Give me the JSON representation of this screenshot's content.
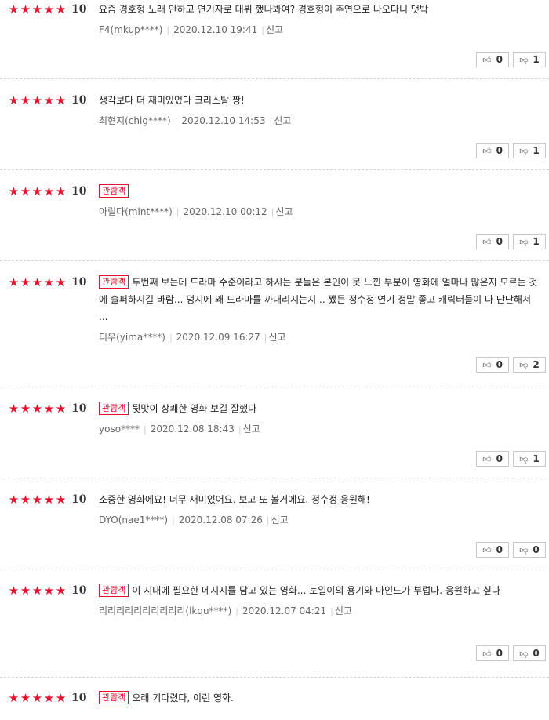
{
  "reviews": [
    {
      "score": "10",
      "badge": "",
      "text": "요즘 경호형 노래 안하고 연기자로 대뷔 했나봐여? 경호형이 주연으로 나오다니 댓박",
      "user": "F4(mkup****)",
      "date": "2020.12.10 19:41",
      "report": "신고",
      "likes": "0",
      "dislikes": "1"
    },
    {
      "score": "10",
      "badge": "",
      "text": "생각보다 더 재미있었다 크리스탈 짱!",
      "user": "최현지(chlg****)",
      "date": "2020.12.10 14:53",
      "report": "신고",
      "likes": "0",
      "dislikes": "1"
    },
    {
      "score": "10",
      "badge": "관람객",
      "text": "",
      "user": "아릴다(mint****)",
      "date": "2020.12.10 00:12",
      "report": "신고",
      "likes": "0",
      "dislikes": "1"
    },
    {
      "score": "10",
      "badge": "관람객",
      "text": "두번째 보는데 드라마 수준이라고 하시는 분들은 본인이 못 느낀 부분이 영화에 얼마나 많은지 모르는 것에 슬퍼하시길 바람... 덩시에 왜 드라마를 까내리시는지 .. 쨌든 정수정 연기 정말 좋고 캐릭터들이 다 단단해서 ...",
      "user": "디우(yima****)",
      "date": "2020.12.09 16:27",
      "report": "신고",
      "likes": "0",
      "dislikes": "2"
    },
    {
      "score": "10",
      "badge": "관람객",
      "text": "뒷맛이 상쾌한 영화 보길 잘했다",
      "user": "yoso****",
      "date": "2020.12.08 18:43",
      "report": "신고",
      "likes": "0",
      "dislikes": "1"
    },
    {
      "score": "10",
      "badge": "",
      "text": "소중한 영화에요! 너무 재미있어요. 보고 또 볼거에요. 정수정 응원해!",
      "user": "DYO(nae1****)",
      "date": "2020.12.08 07:26",
      "report": "신고",
      "likes": "0",
      "dislikes": "0"
    },
    {
      "score": "10",
      "badge": "관람객",
      "text": "이 시대에 필요한 메시지를 담고 있는 영화... 토일이의 용기와 마인드가 부럽다. 응원하고 싶다",
      "user": "리리리리리리리리리리(lkqu****)",
      "date": "2020.12.07 04:21",
      "report": "신고",
      "likes": "0",
      "dislikes": "0"
    },
    {
      "score": "10",
      "badge": "관람객",
      "text": "오래 기다렸다, 이런 영화.",
      "user": "",
      "date": "",
      "report": "",
      "likes": "",
      "dislikes": ""
    }
  ]
}
